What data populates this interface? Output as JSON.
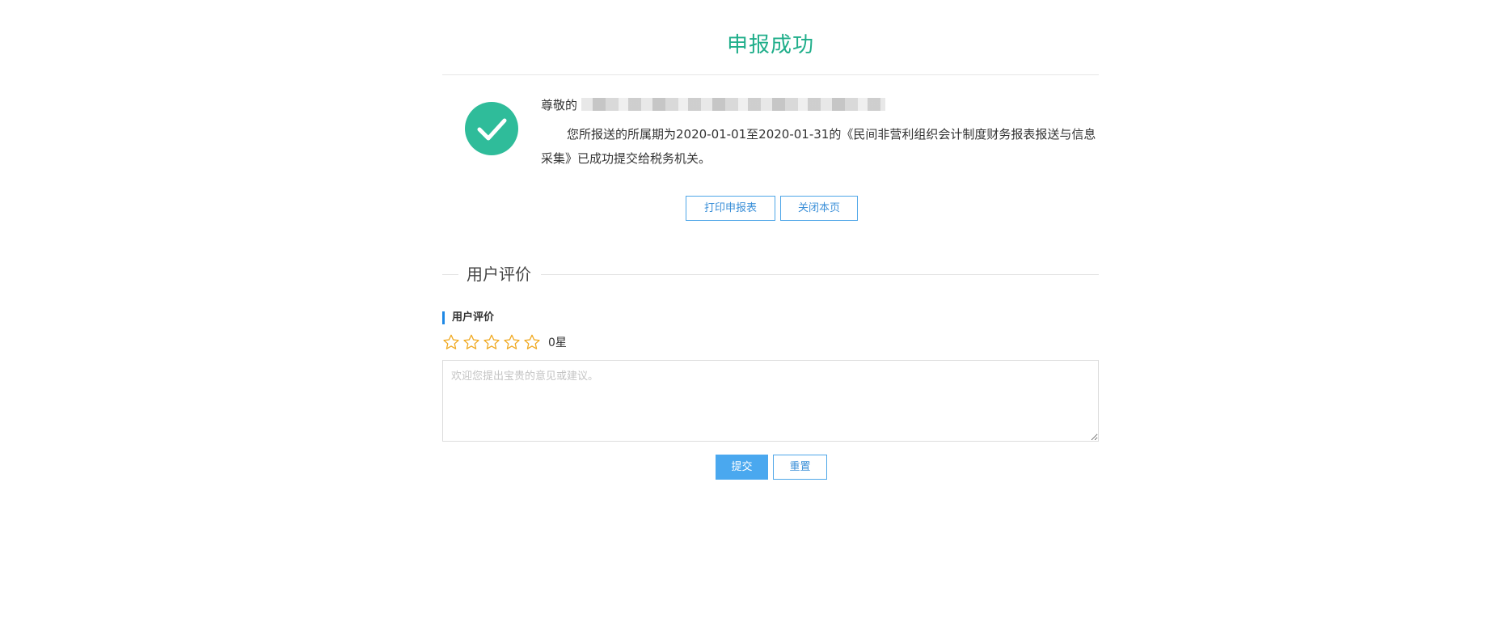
{
  "header": {
    "title": "申报成功"
  },
  "message": {
    "greeting": "尊敬的",
    "body": "您所报送的所属期为2020-01-01至2020-01-31的《民间非营利组织会计制度财务报表报送与信息采集》已成功提交给税务机关。"
  },
  "actions": {
    "print_label": "打印申报表",
    "close_label": "关闭本页"
  },
  "rating_section": {
    "section_title": "用户评价",
    "sub_label": "用户评价",
    "star_max": 5,
    "star_value": 0,
    "star_count_text": "0星",
    "star_color": "#f0a81e",
    "feedback_placeholder": "欢迎您提出宝贵的意见或建议。",
    "submit_label": "提交",
    "reset_label": "重置"
  },
  "colors": {
    "accent_green": "#1fae8a",
    "icon_green": "#2fbc9a",
    "primary_blue": "#4aa8ef"
  },
  "icons": {
    "success": "check-circle-icon",
    "star": "star-outline-icon"
  }
}
